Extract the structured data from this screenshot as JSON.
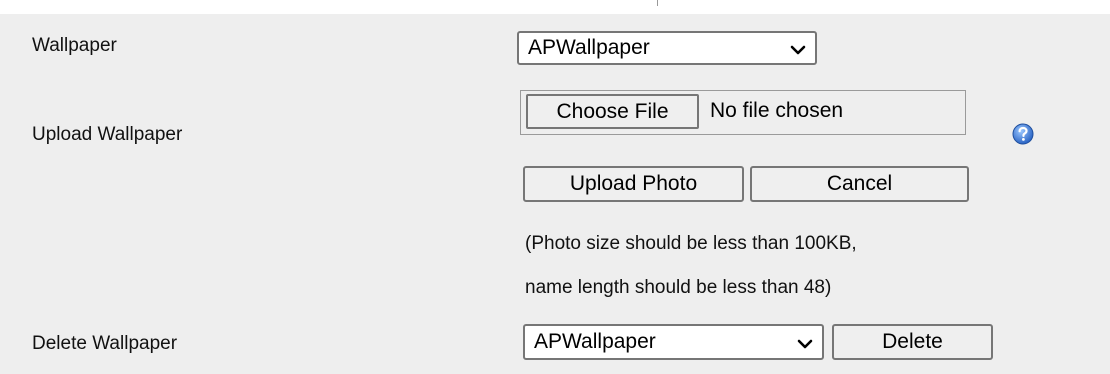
{
  "rows": {
    "wallpaper": {
      "label": "Wallpaper",
      "selected": "APWallpaper"
    },
    "upload": {
      "label": "Upload Wallpaper",
      "choose_file_label": "Choose File",
      "file_status": "No file chosen",
      "upload_button": "Upload Photo",
      "cancel_button": "Cancel",
      "note_line1": "(Photo size should be less than 100KB,",
      "note_line2": "name length should be less than 48)",
      "help_icon": "help-question-icon"
    },
    "delete": {
      "label": "Delete Wallpaper",
      "selected": "APWallpaper",
      "delete_button": "Delete"
    }
  },
  "colors": {
    "panel_background": "#eeeeee",
    "help_icon_blue": "#3a7bd5"
  }
}
